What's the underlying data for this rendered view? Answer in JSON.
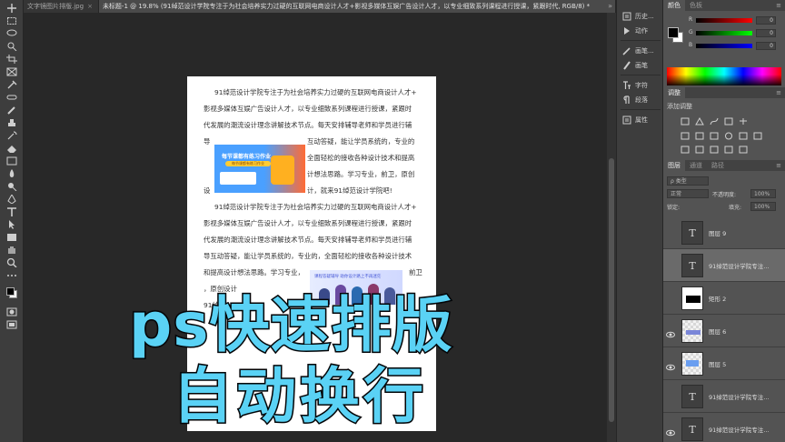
{
  "tabs": [
    {
      "label": "文字镜图片排版.jpg",
      "close": "×",
      "active": false
    },
    {
      "label": "未标题-1 @ 19.8% (91绰范设计学院专注于为社会培养实力过硬的互联网电商设计人才+影视多媒体互娱广告设计人才，以专业细致系列课程进行授课，紧跟时代, RGB/8) *",
      "close": "×",
      "active": true
    }
  ],
  "tab_scroll": "»",
  "document": {
    "lines": [
      "91绰范设计学院专注于为社会培养实力过硬的互联网电商设计人才+",
      "影视多媒体互娱广告设计人才，以专业细致系列课程进行授课，紧跟时",
      "代发展的潮流设计理念讲解技术节点。每天安排辅导老师和学员进行辅",
      "导",
      "互动答疑，能让学员系统的，专业的",
      "全面轻松的接收各种设计技术和提高",
      "计想法思路。学习专业，前卫，原创",
      "设",
      "计，就来91绰范设计学院吧!",
      "91绰范设计学院专注于为社会培养实力过硬的互联网电商设计人才+",
      "影视多媒体互娱广告设计人才，以专业细致系列课程进行授课，紧跟时",
      "代发展的潮流设计理念讲解技术节点。每天安排辅导老师和学员进行辅",
      "导互动答疑，能让学员系统的，专业的，全面轻松的接收各种设计技术",
      "和提高设计想法思路。学习专业，",
      "前卫",
      "，原创设计",
      "91绰"
    ],
    "promo1": {
      "title": "每节课都有练习作业",
      "sub": "每节课都有练习作业"
    },
    "promo2": {
      "text": "课程答疑辅导 助你设计路上不再迷茫"
    }
  },
  "overlay": {
    "line1": "ps快速排版",
    "line2": "自动换行",
    "color": "#5ad2f5"
  },
  "dock": [
    {
      "icon": "history-icon",
      "label": "历史..."
    },
    {
      "icon": "actions-icon",
      "label": "动作"
    },
    {
      "icon": "brush-settings-icon",
      "label": "画笔..."
    },
    {
      "icon": "brushes-icon",
      "label": "画笔"
    },
    {
      "icon": "character-icon",
      "label": "字符"
    },
    {
      "icon": "paragraph-icon",
      "label": "段落"
    },
    {
      "icon": "properties-icon",
      "label": "属性"
    }
  ],
  "color_panel": {
    "tabs": [
      "颜色",
      "色板"
    ],
    "menu": "≡",
    "sliders": [
      {
        "label": "R",
        "value": "0"
      },
      {
        "label": "G",
        "value": "0"
      },
      {
        "label": "B",
        "value": "0"
      }
    ]
  },
  "adjust_panel": {
    "title": "调整",
    "add_label": "添加调整",
    "menu": "≡"
  },
  "layers_panel": {
    "tabs": [
      "图层",
      "通道",
      "路径"
    ],
    "menu": "≡",
    "filter_label": "ρ 类型",
    "blend_mode": "正常",
    "opacity_label": "不透明度:",
    "opacity_value": "100%",
    "lock_label": "锁定:",
    "fill_label": "填充:",
    "fill_value": "100%",
    "layers": [
      {
        "name": "图层 9",
        "thumb": "T",
        "type": "text",
        "visible": false,
        "selected": false
      },
      {
        "name": "91绰范设计学院专注...",
        "thumb": "T",
        "type": "text",
        "visible": false,
        "selected": true
      },
      {
        "name": "矩形 2",
        "thumb": "",
        "type": "shape",
        "visible": false,
        "selected": false
      },
      {
        "name": "图层 6",
        "thumb": "",
        "type": "image",
        "visible": true,
        "selected": false
      },
      {
        "name": "图层 5",
        "thumb": "",
        "type": "image",
        "visible": true,
        "selected": false
      },
      {
        "name": "91绰范设计学院专注...",
        "thumb": "T",
        "type": "text",
        "visible": false,
        "selected": false
      },
      {
        "name": "91绰范设计学院专注...",
        "thumb": "T",
        "type": "text",
        "visible": true,
        "selected": false
      }
    ]
  }
}
